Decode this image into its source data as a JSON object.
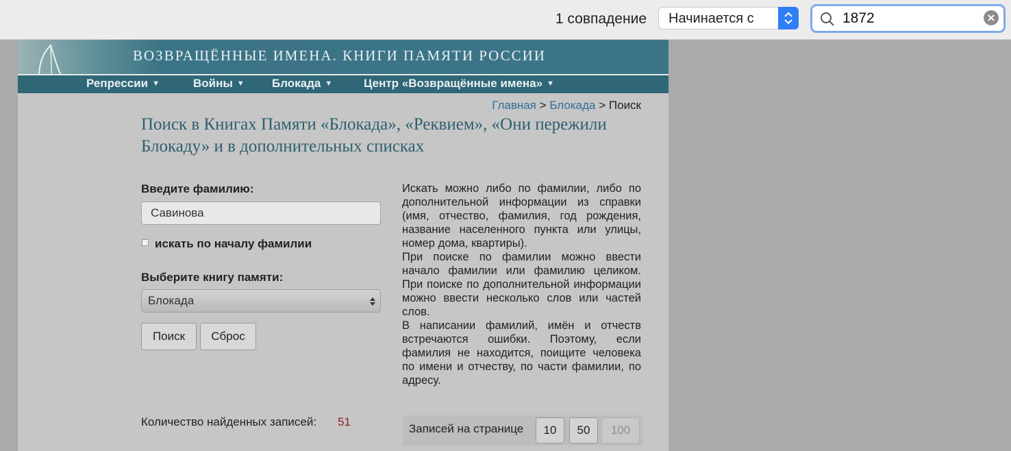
{
  "findbar": {
    "match_count": "1 совпадение",
    "mode": "Начинается с",
    "query": "1872"
  },
  "site": {
    "banner_title": "ВОЗВРАЩЁННЫЕ ИМЕНА. КНИГИ ПАМЯТИ РОССИИ",
    "nav": [
      {
        "label": "Репрессии"
      },
      {
        "label": "Войны"
      },
      {
        "label": "Блокада"
      },
      {
        "label": "Центр «Возвращённые имена»"
      }
    ]
  },
  "breadcrumb": {
    "home": "Главная",
    "section": "Блокада",
    "current": "Поиск",
    "sep": ">"
  },
  "heading": "Поиск в Книгах Памяти «Блокада», «Реквием», «Они пережили Блокаду» и в дополнительных списках",
  "form": {
    "surname_label": "Введите фамилию:",
    "surname_value": "Савинова",
    "prefix_checkbox_label": "искать по началу фамилии",
    "book_label": "Выберите книгу памяти:",
    "book_value": "Блокада",
    "search_button": "Поиск",
    "reset_button": "Сброс"
  },
  "help": [
    "Искать можно либо по фамилии, либо по дополнительной информации из справки (имя, отчество, фамилия, год рождения, название населенного пункта или улицы, номер дома, квартиры).",
    "При поиске по фамилии можно ввести начало фамилии или фамилию целиком. При поиске по дополнительной информации можно ввести несколько слов или частей слов.",
    "В написании фамилий, имён и отчеств встречаются ошибки. Поэтому, если фамилия не находится, поищите человека по имени и отчеству, по части фамилии, по адресу."
  ],
  "results": {
    "count_label": "Количество найденных записей:",
    "count": "51",
    "per_page_label": "Записей на странице",
    "per_page_options": [
      "10",
      "50",
      "100"
    ]
  }
}
